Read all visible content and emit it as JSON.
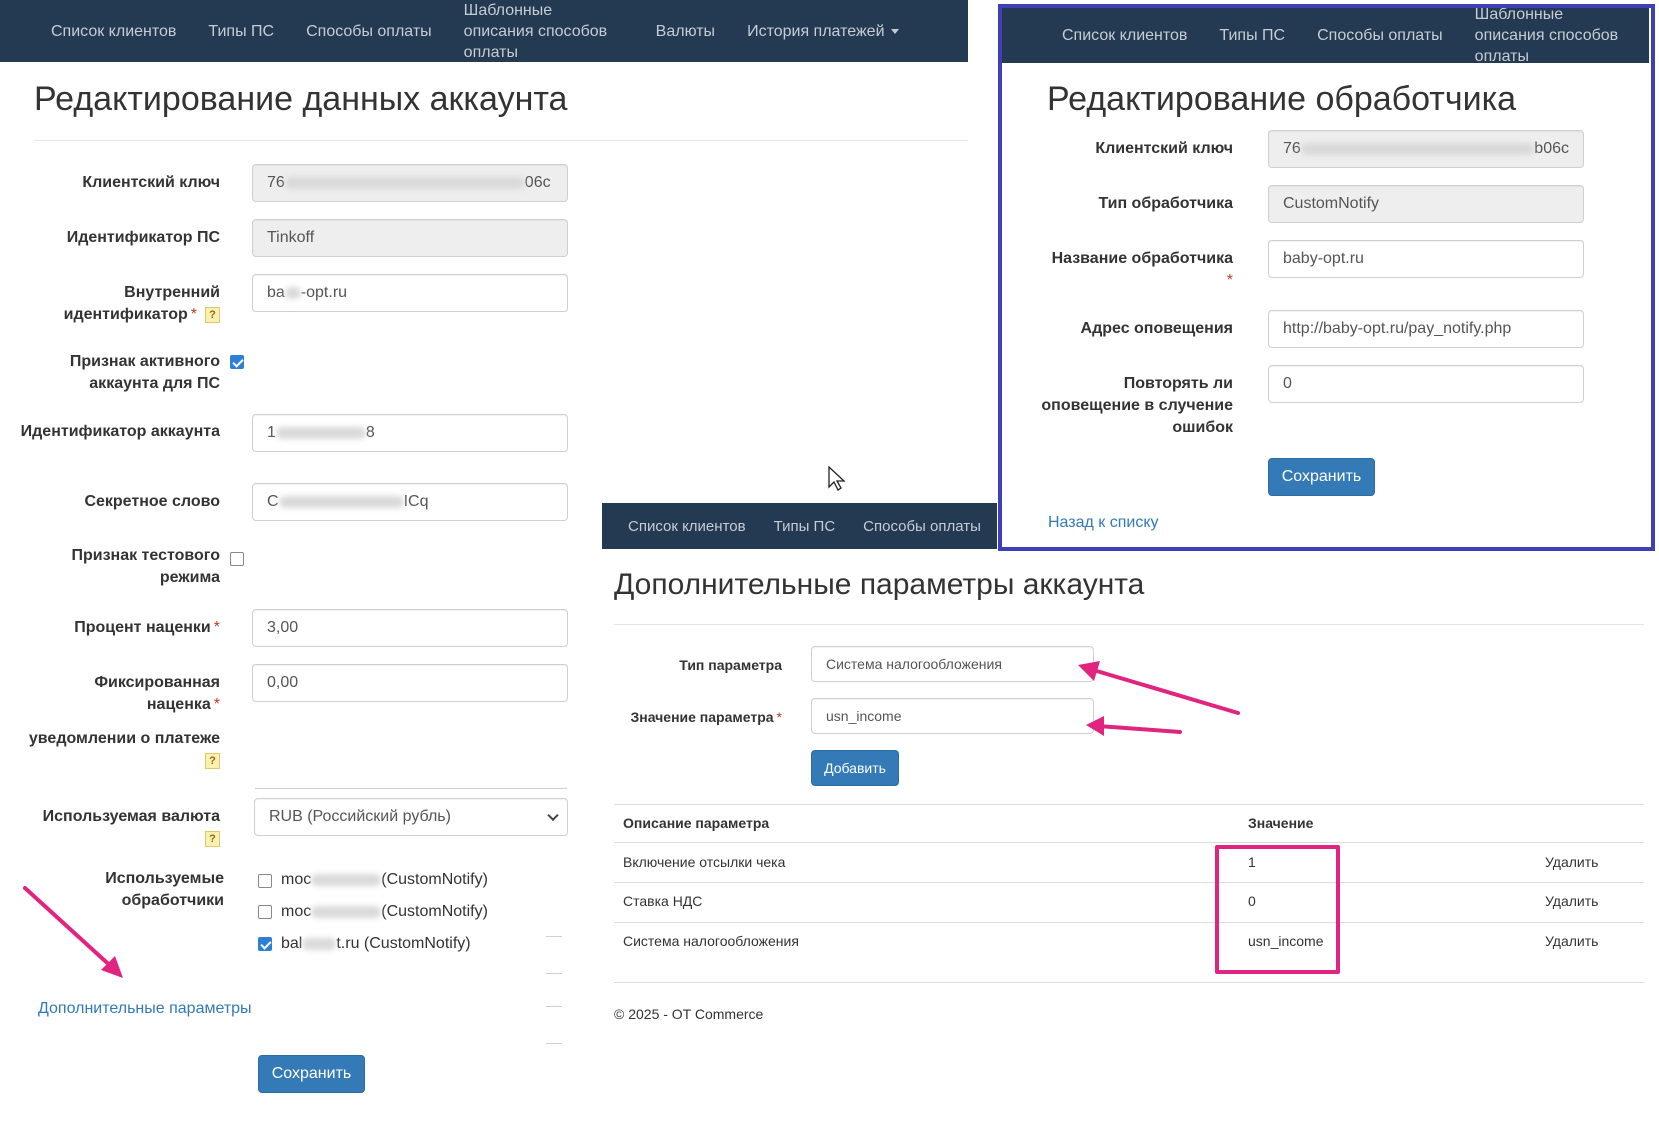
{
  "colors": {
    "navbar": "#243a52",
    "accent": "#337ab7",
    "annotation": "#e0247f",
    "frame": "#3f3fb8"
  },
  "navbar_left": {
    "items": [
      "Список клиентов",
      "Типы ПС",
      "Способы оплаты",
      "Шаблонные описания способов оплаты",
      "Валюты",
      "История платежей"
    ]
  },
  "left_panel": {
    "title": "Редактирование данных аккаунта",
    "fields": {
      "client_key": {
        "label": "Клиентский ключ",
        "value_start": "76",
        "value_end": "06c"
      },
      "ps_id": {
        "label": "Идентификатор ПС",
        "value": "Tinkoff"
      },
      "internal_id": {
        "label": "Внутренний идентификатор",
        "value_start": "ba",
        "value_end": "-opt.ru"
      },
      "active": {
        "label": "Признак активного аккаунта для ПС",
        "checked": true
      },
      "account_id": {
        "label": "Идентификатор аккаунта",
        "value_start": "1",
        "value_end": "8"
      },
      "secret": {
        "label": "Секретное слово",
        "value_start": "C",
        "value_end": "ICq"
      },
      "test_mode": {
        "label": "Признак тестового режима",
        "checked": false
      },
      "markup_percent": {
        "label": "Процент наценки",
        "value": "3,00"
      },
      "fixed_markup": {
        "label": "Фиксированная наценка",
        "value": "0,00"
      },
      "notify_label": "уведомлении о платеже",
      "currency": {
        "label": "Используемая валюта",
        "value": "RUB (Российский рубль)"
      },
      "handlers": {
        "label": "Используемые обработчики",
        "items": [
          {
            "prefix": "moc",
            "suffix": "(CustomNotify)",
            "checked": false
          },
          {
            "prefix": "moc",
            "suffix": "(CustomNotify)",
            "checked": false
          },
          {
            "prefix": "bal",
            "suffix": "t.ru (CustomNotify)",
            "checked": true
          }
        ]
      }
    },
    "extra_params_link": "Дополнительные параметры",
    "save_button": "Сохранить"
  },
  "right_panel": {
    "navbar": [
      "Список клиентов",
      "Типы ПС",
      "Способы оплаты",
      "Шаблонные описания способов оплаты"
    ],
    "title": "Редактирование обработчика",
    "fields": {
      "client_key": {
        "label": "Клиентский ключ",
        "value_start": "76",
        "value_end": "b06c"
      },
      "handler_type": {
        "label": "Тип обработчика",
        "value": "CustomNotify"
      },
      "handler_name": {
        "label": "Название обработчика",
        "value": "baby-opt.ru"
      },
      "notify_url": {
        "label": "Адрес оповещения",
        "value": "http://baby-opt.ru/pay_notify.php"
      },
      "retry": {
        "label": "Повторять ли оповещение в случение ошибок",
        "value": "0"
      }
    },
    "save_button": "Сохранить",
    "back_link": "Назад к списку"
  },
  "bottom_panel": {
    "navbar": [
      "Список клиентов",
      "Типы ПС",
      "Способы оплаты"
    ],
    "title": "Дополнительные параметры аккаунта",
    "param_type": {
      "label": "Тип параметра",
      "value": "Система налогообложения"
    },
    "param_value": {
      "label": "Значение параметра",
      "value": "usn_income"
    },
    "add_button": "Добавить",
    "table": {
      "headers": [
        "Описание параметра",
        "Значение"
      ],
      "rows": [
        {
          "description": "Включение отсылки чека",
          "value": "1",
          "action": "Удалить"
        },
        {
          "description": "Ставка НДС",
          "value": "0",
          "action": "Удалить"
        },
        {
          "description": "Система налогообложения",
          "value": "usn_income",
          "action": "Удалить"
        }
      ]
    },
    "footer": "© 2025 - OT Commerce"
  }
}
